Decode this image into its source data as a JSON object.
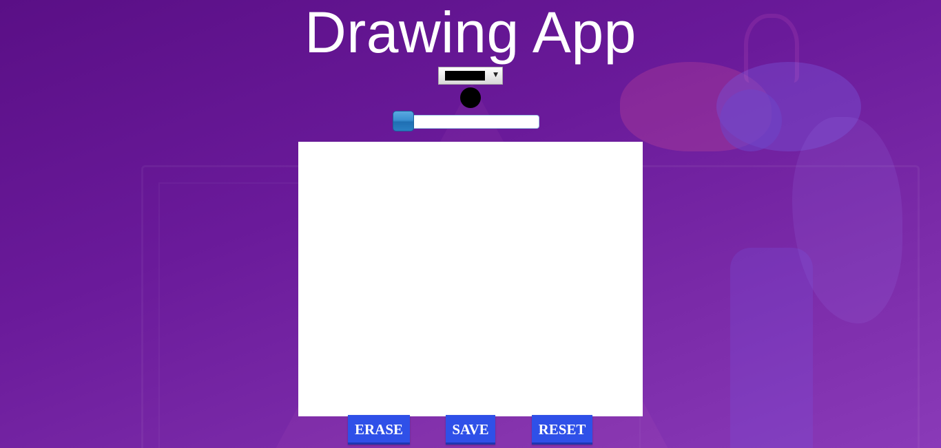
{
  "app": {
    "title": "Drawing App"
  },
  "controls": {
    "color_select": {
      "selected_color": "#000000"
    },
    "brush_preview": {
      "color": "#000000"
    },
    "size_slider": {
      "value_fraction": 0.0
    }
  },
  "canvas": {
    "background": "#ffffff"
  },
  "buttons": {
    "erase_label": "ERASE",
    "save_label": "SAVE",
    "reset_label": "RESET"
  },
  "colors": {
    "button_blue": "#2f50e8",
    "slider_thumb": "#2a7fc2",
    "background_purple": "#6a1a9a"
  },
  "icons": {
    "dropdown": "chevron-down-icon"
  }
}
